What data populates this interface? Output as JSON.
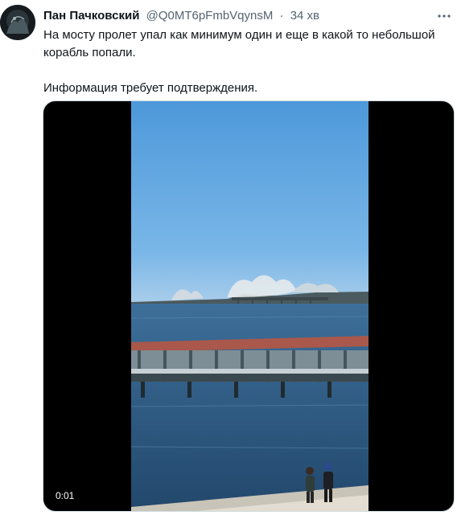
{
  "tweet": {
    "author": {
      "display_name": "Пан Пачковский",
      "handle": "@Q0MT6pFmbVqynsM"
    },
    "separator": "·",
    "time": "34 хв",
    "more_icon": "more-horizontal-icon",
    "text": {
      "line1": "На мосту пролет упал как минимум один и еще в какой то небольшой корабль попали.",
      "line2": "Информация требует подтверждения."
    },
    "media": {
      "type": "video",
      "timestamp": "0:01"
    }
  },
  "colors": {
    "text_primary": "#0f1419",
    "text_secondary": "#536471",
    "sky": "#5aa3df",
    "sea": "#2f5c86"
  }
}
